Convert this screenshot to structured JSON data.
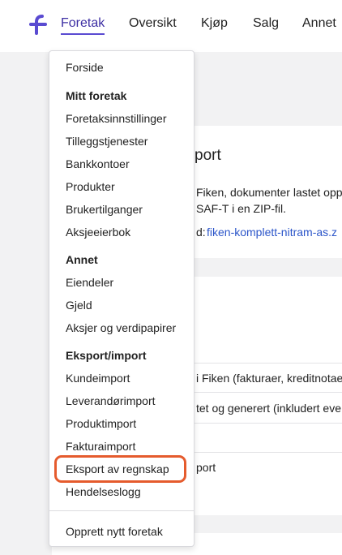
{
  "nav": {
    "items": [
      "Foretak",
      "Oversikt",
      "Kjøp",
      "Salg",
      "Annet"
    ]
  },
  "background": {
    "card1": {
      "heading_fragment": "port",
      "line1": "Fiken, dokumenter lastet opp",
      "line2": "SAF-T i en ZIP-fil.",
      "line3_prefix": "d:",
      "line3_link": "fiken-komplett-nitram-as.z"
    },
    "card2": {
      "row1": "i Fiken (fakturaer, kreditnotae",
      "row2": "tet og generert (inkludert eve",
      "row3": "port"
    }
  },
  "menu": {
    "home": "Forside",
    "groups": [
      {
        "heading": "Mitt foretak",
        "items": [
          "Foretaksinnstillinger",
          "Tilleggstjenester",
          "Bankkontoer",
          "Produkter",
          "Brukertilganger",
          "Aksjeeierbok"
        ]
      },
      {
        "heading": "Annet",
        "items": [
          "Eiendeler",
          "Gjeld",
          "Aksjer og verdipapirer"
        ]
      },
      {
        "heading": "Eksport/import",
        "items": [
          "Kundeimport",
          "Leverandørimport",
          "Produktimport",
          "Fakturaimport",
          "Eksport av regnskap",
          "Hendelseslogg"
        ]
      }
    ],
    "footer_action": "Opprett nytt foretak"
  },
  "colors": {
    "accent": "#5a4bd1",
    "highlight": "#e55b2d",
    "link": "#2b55c9"
  }
}
